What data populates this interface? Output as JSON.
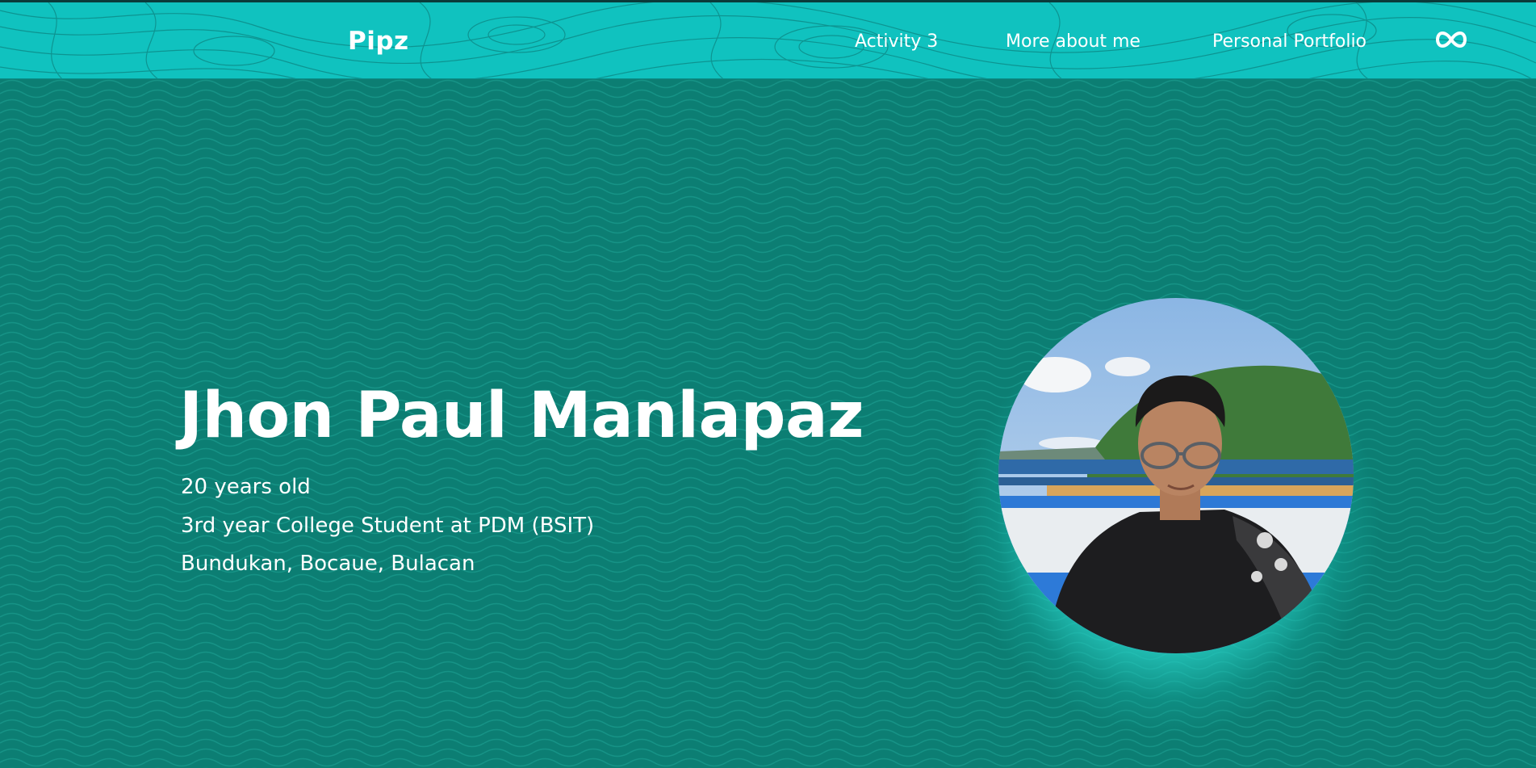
{
  "header": {
    "brand": "Pipz",
    "nav": {
      "activity": "Activity 3",
      "more_about": "More about me",
      "portfolio": "Personal Portfolio"
    },
    "icon": "infinity-icon"
  },
  "profile": {
    "name": "Jhon Paul Manlapaz",
    "age": "20 years old",
    "school": "3rd year College Student at PDM (BSIT)",
    "address": "Bundukan, Bocaue, Bulacan"
  },
  "colors": {
    "header_bg": "#10c2bf",
    "hero_bg": "#0c7e73",
    "glow": "#50f0e6",
    "text": "#ffffff"
  }
}
